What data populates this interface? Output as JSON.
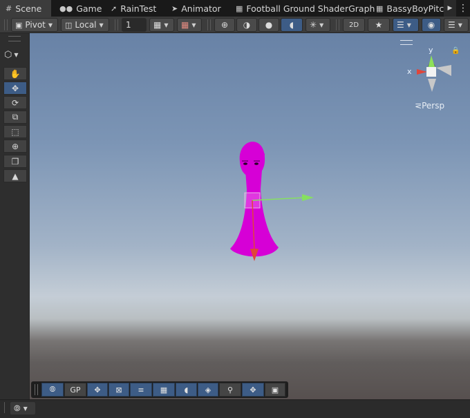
{
  "tabs": [
    {
      "icon": "grid-icon",
      "label": "Scene",
      "active": true
    },
    {
      "icon": "gamepad-icon",
      "label": "Game",
      "active": false
    },
    {
      "icon": "brush-icon",
      "label": "RainTest",
      "active": false
    },
    {
      "icon": "animator-icon",
      "label": "Animator",
      "active": false
    },
    {
      "icon": "shadergraph-icon",
      "label": "Football Ground ShaderGraph",
      "active": false
    },
    {
      "icon": "shadergraph-icon",
      "label": "BassyBoyPitchl",
      "active": false
    }
  ],
  "toolbar": {
    "pivot_label": "Pivot",
    "space_label": "Local",
    "grid_snap_value": "1"
  },
  "gizmo": {
    "axis_x": "x",
    "axis_y": "y",
    "projection_label": "Persp"
  },
  "overlay_toolbar": {
    "gp_label": "GP"
  },
  "colors": {
    "accent": "#3d5c86",
    "object": "#d600d6",
    "x_axis": "#e0463a",
    "y_axis": "#86e060"
  }
}
